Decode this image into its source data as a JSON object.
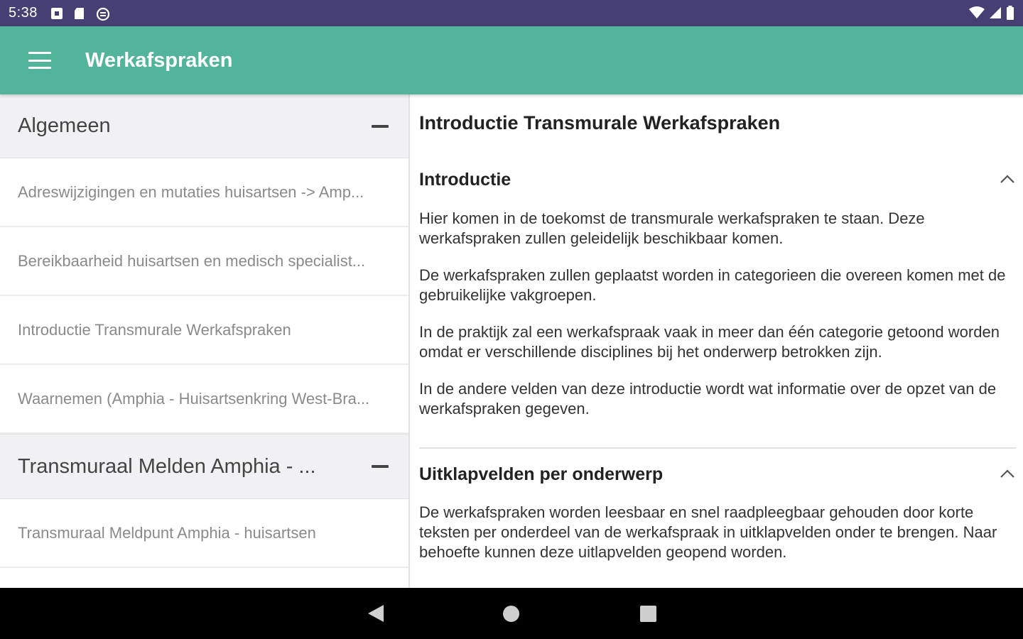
{
  "status_bar": {
    "time": "5:38",
    "icons": [
      "notification-icon",
      "sd-card-icon",
      "sync-icon",
      "wifi-icon",
      "signal-icon",
      "battery-icon"
    ]
  },
  "app_bar": {
    "title": "Werkafspraken",
    "color": "#52b49a"
  },
  "sidebar": {
    "groups": [
      {
        "label": "Algemeen",
        "items": [
          {
            "label": "Adreswijzigingen en mutaties huisartsen -> Amp..."
          },
          {
            "label": "Bereikbaarheid huisartsen en medisch specialist..."
          },
          {
            "label": "Introductie Transmurale Werkafspraken"
          },
          {
            "label": "Waarnemen (Amphia - Huisartsenkring West-Bra..."
          }
        ]
      },
      {
        "label": "Transmuraal Melden Amphia - ...",
        "items": [
          {
            "label": "Transmuraal Meldpunt Amphia - huisartsen"
          }
        ]
      }
    ]
  },
  "detail": {
    "title": "Introductie Transmurale Werkafspraken",
    "sections": [
      {
        "title": "Introductie",
        "paragraphs": [
          "Hier komen in de toekomst de transmurale werkafspraken te staan. Deze werkafspraken zullen geleidelijk beschikbaar komen.",
          "De werkafspraken zullen geplaatst worden in categorieen die overeen komen met de gebruikelijke vakgroepen.",
          "In de praktijk zal een werkafspraak vaak in meer dan één categorie getoond worden omdat er verschillende disciplines bij het onderwerp betrokken zijn.",
          "In de andere velden van deze introductie wordt wat informatie over de opzet van de werkafspraken gegeven."
        ]
      },
      {
        "title": "Uitklapvelden per onderwerp",
        "paragraphs": [
          "De werkafspraken worden leesbaar en snel raadpleegbaar gehouden door korte teksten per onderdeel van de werkafspraak in uitklapvelden onder te brengen. Naar behoefte kunnen deze uitlapvelden geopend worden."
        ]
      }
    ]
  }
}
